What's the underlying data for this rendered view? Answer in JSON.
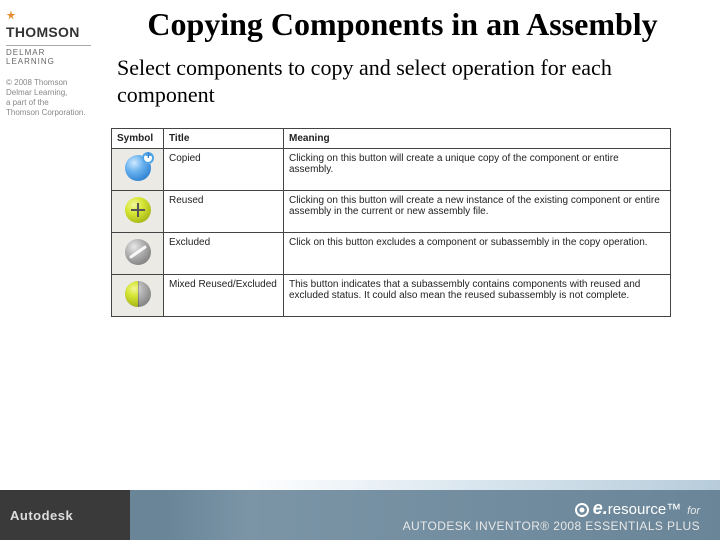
{
  "sidebar": {
    "brand_name": "THOMSON",
    "brand_sub": "DELMAR LEARNING",
    "copyright_l1": "© 2008 Thomson",
    "copyright_l2": "Delmar Learning,",
    "copyright_l3": "a part of the",
    "copyright_l4": "Thomson Corporation."
  },
  "content": {
    "title": "Copying Components in an Assembly",
    "subtitle": "Select components to copy and select operation for each component"
  },
  "table": {
    "headers": {
      "symbol": "Symbol",
      "title": "Title",
      "meaning": "Meaning"
    },
    "rows": [
      {
        "icon": "copied",
        "title": "Copied",
        "meaning": "Clicking on this button will create a unique copy of the component or entire assembly."
      },
      {
        "icon": "reused",
        "title": "Reused",
        "meaning": "Clicking on this button will create a new instance of the existing component or entire assembly in the current or new assembly file."
      },
      {
        "icon": "excluded",
        "title": "Excluded",
        "meaning": "Click on this button excludes a component or subassembly in the copy operation."
      },
      {
        "icon": "mixed",
        "title": "Mixed Reused/Excluded",
        "meaning": "This button indicates that a subassembly contains components with reused and excluded status. It could also mean the reused subassembly is not complete."
      }
    ]
  },
  "footer": {
    "autodesk": "Autodesk",
    "eresource_prefix": "e.",
    "eresource_word": "resource",
    "eresource_tm": "™",
    "eresource_for": "for",
    "product_line": "AUTODESK INVENTOR® 2008 ESSENTIALS PLUS"
  }
}
